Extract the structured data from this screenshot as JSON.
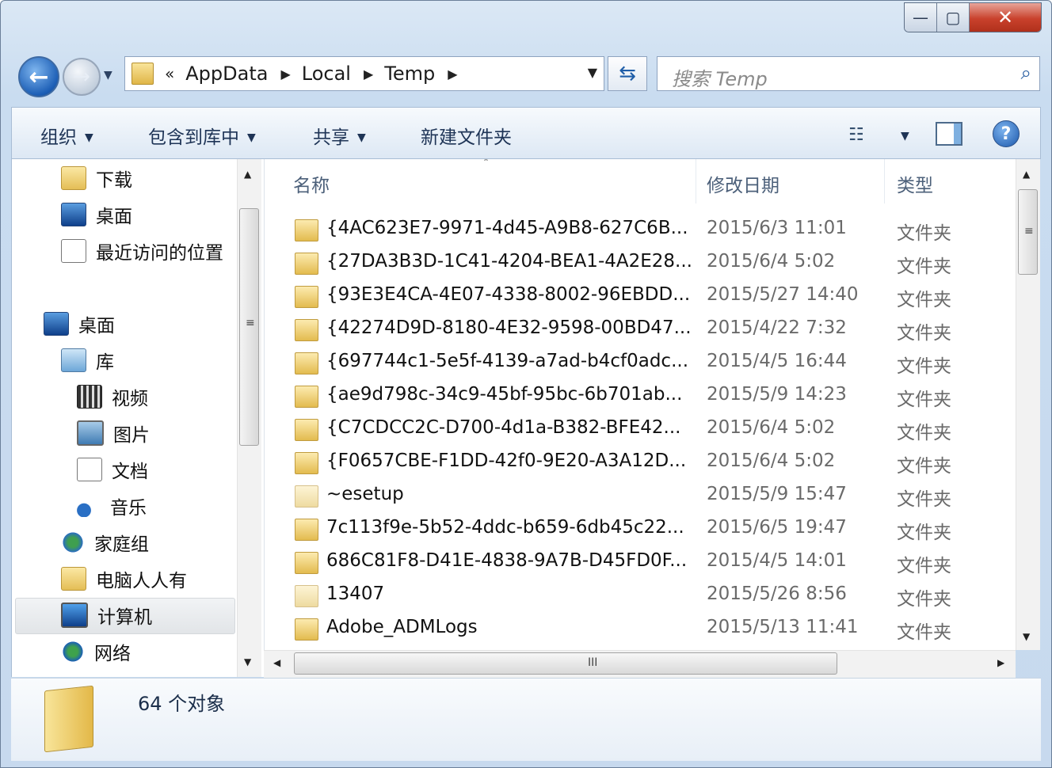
{
  "window": {
    "caption_buttons": {
      "minimize": "—",
      "maximize": "▢",
      "close": "✕"
    }
  },
  "nav": {
    "back_icon": "back-arrow-icon",
    "forward_icon": "forward-arrow-icon",
    "breadcrumb": [
      "AppData",
      "Local",
      "Temp"
    ],
    "breadcrumb_prefix": "«",
    "search_placeholder": "搜索 Temp"
  },
  "toolbar": {
    "organize": "组织",
    "include_in_library": "包含到库中",
    "share": "共享",
    "new_folder": "新建文件夹"
  },
  "sidebar": {
    "favorites": [
      {
        "label": "下载",
        "icon": "download-folder-icon"
      },
      {
        "label": "桌面",
        "icon": "desktop-icon"
      },
      {
        "label": "最近访问的位置",
        "icon": "recent-places-icon"
      }
    ],
    "desktop": {
      "label": "桌面",
      "icon": "desktop-icon"
    },
    "library": {
      "label": "库",
      "icon": "library-icon"
    },
    "library_items": [
      {
        "label": "视频",
        "icon": "video-icon"
      },
      {
        "label": "图片",
        "icon": "pictures-icon"
      },
      {
        "label": "文档",
        "icon": "documents-icon"
      },
      {
        "label": "音乐",
        "icon": "music-icon"
      }
    ],
    "homegroup": {
      "label": "家庭组",
      "icon": "homegroup-icon"
    },
    "user": {
      "label": "电脑人人有",
      "icon": "user-folder-icon"
    },
    "computer": {
      "label": "计算机",
      "icon": "computer-icon"
    },
    "network": {
      "label": "网络",
      "icon": "network-icon"
    }
  },
  "list": {
    "columns": {
      "name": "名称",
      "date": "修改日期",
      "type": "类型"
    },
    "rows": [
      {
        "name": "{4AC623E7-9971-4d45-A9B8-627C6B...",
        "date": "2015/6/3 11:01",
        "type": "文件夹"
      },
      {
        "name": "{27DA3B3D-1C41-4204-BEA1-4A2E28...",
        "date": "2015/6/4 5:02",
        "type": "文件夹"
      },
      {
        "name": "{93E3E4CA-4E07-4338-8002-96EBDD...",
        "date": "2015/5/27 14:40",
        "type": "文件夹"
      },
      {
        "name": "{42274D9D-8180-4E32-9598-00BD47...",
        "date": "2015/4/22 7:32",
        "type": "文件夹"
      },
      {
        "name": "{697744c1-5e5f-4139-a7ad-b4cf0adc...",
        "date": "2015/4/5 16:44",
        "type": "文件夹"
      },
      {
        "name": "{ae9d798c-34c9-45bf-95bc-6b701ab...",
        "date": "2015/5/9 14:23",
        "type": "文件夹"
      },
      {
        "name": "{C7CDCC2C-D700-4d1a-B382-BFE42...",
        "date": "2015/6/4 5:02",
        "type": "文件夹"
      },
      {
        "name": "{F0657CBE-F1DD-42f0-9E20-A3A12D...",
        "date": "2015/6/4 5:02",
        "type": "文件夹"
      },
      {
        "name": "~esetup",
        "date": "2015/5/9 15:47",
        "type": "文件夹"
      },
      {
        "name": "7c113f9e-5b52-4ddc-b659-6db45c22...",
        "date": "2015/6/5 19:47",
        "type": "文件夹"
      },
      {
        "name": "686C81F8-D41E-4838-9A7B-D45FD0F...",
        "date": "2015/4/5 14:01",
        "type": "文件夹"
      },
      {
        "name": "13407",
        "date": "2015/5/26 8:56",
        "type": "文件夹"
      },
      {
        "name": "Adobe_ADMLogs",
        "date": "2015/5/13 11:41",
        "type": "文件夹"
      }
    ]
  },
  "status": {
    "count": "64 个对象"
  }
}
